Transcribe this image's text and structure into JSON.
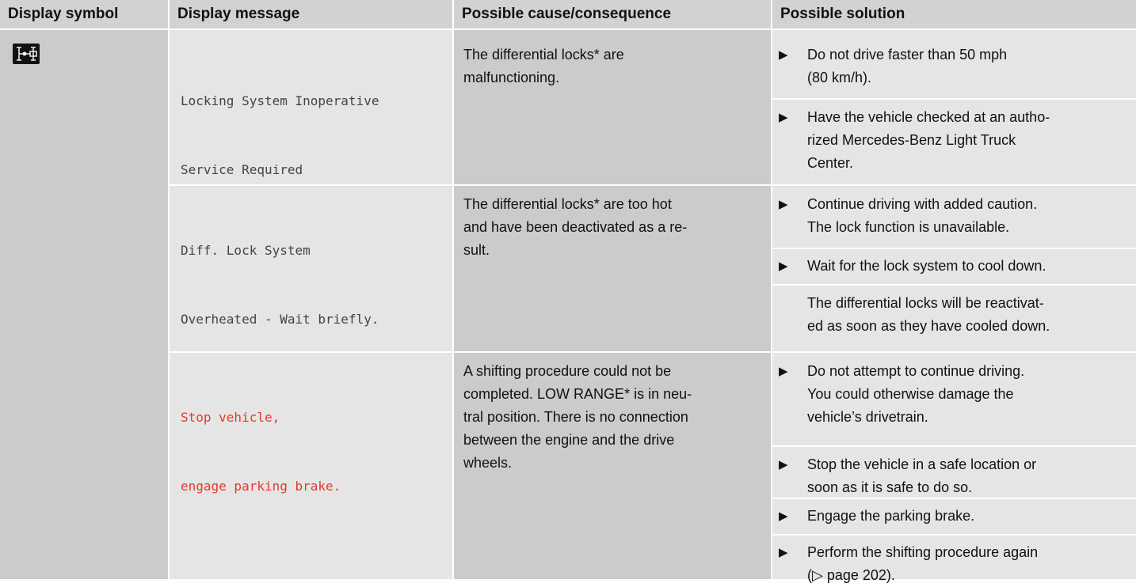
{
  "headers": {
    "symbol": "Display symbol",
    "message": "Display message",
    "cause": "Possible cause/consequence",
    "solution": "Possible solution"
  },
  "icon": "differential-lock-icon",
  "rows": [
    {
      "message_l1": "Locking System Inoperative",
      "message_l2": "Service Required",
      "cause_l1": "The differential locks* are",
      "cause_l2": "malfunctioning.",
      "sol1_l1": "Do not drive faster than 50 mph",
      "sol1_l2": "(80 km/h).",
      "sol2_l1": "Have the vehicle checked at an autho-",
      "sol2_l2": "rized Mercedes-Benz Light Truck",
      "sol2_l3": "Center."
    },
    {
      "message_l1": "Diff. Lock System",
      "message_l2": "Overheated - Wait briefly.",
      "cause_l1": "The differential locks* are too hot",
      "cause_l2": "and have been deactivated as a re-",
      "cause_l3": "sult.",
      "sol1_l1": "Continue driving with added caution.",
      "sol1_l2": "The lock function is unavailable.",
      "sol2_l1": "Wait for the lock system to cool down.",
      "note_l1": "The differential locks will be reactivat-",
      "note_l2": "ed as soon as they have cooled down."
    },
    {
      "message_l1": "Stop vehicle,",
      "message_l2": "engage parking brake.",
      "message_color": "#e5372e",
      "cause_l1": "A shifting procedure could not be",
      "cause_l2": "completed. LOW RANGE* is in neu-",
      "cause_l3": "tral position. There is no connection",
      "cause_l4": "between the engine and the drive",
      "cause_l5": "wheels.",
      "sol1_l1": "Do not attempt to continue driving.",
      "sol1_l2": "You could otherwise damage the",
      "sol1_l3": "vehicle’s drivetrain.",
      "sol2_l1": "Stop the vehicle in a safe location or",
      "sol2_l2": "soon as it is safe to do so.",
      "sol3_l1": "Engage the parking brake.",
      "sol4_l1": "Perform the shifting procedure again",
      "sol4_l2": "(▷ page 202)."
    }
  ]
}
